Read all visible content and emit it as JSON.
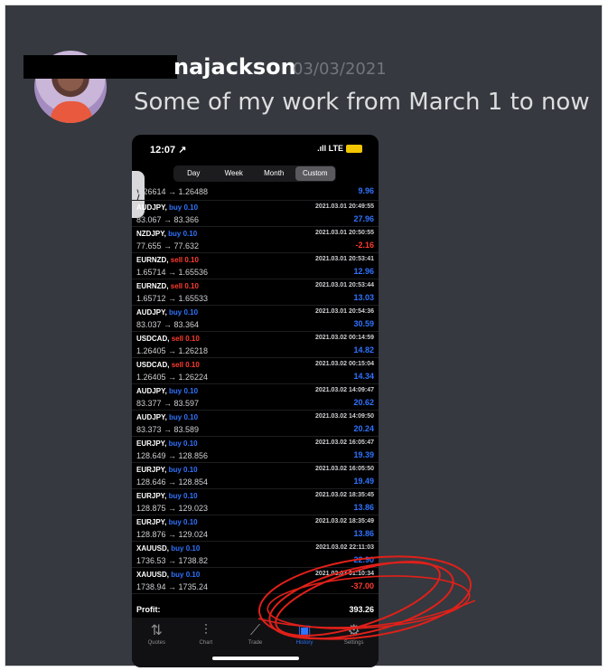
{
  "message": {
    "username": "najackson",
    "timestamp": "03/03/2021",
    "text": "Some of my work from March 1 to now"
  },
  "phone": {
    "clock": "12:07 ↗",
    "network": ".ıll LTE",
    "segments": [
      "Day",
      "Week",
      "Month",
      "Custom"
    ],
    "active_segment": "Custom",
    "side_tab_icon": "chevron-right",
    "trades": [
      {
        "symbol": "",
        "side": "",
        "prices": "1.26614 → 1.26488",
        "time": "",
        "pl": "9.96",
        "partial": true
      },
      {
        "symbol": "AUDJPY,",
        "side": "buy 0.10",
        "prices": "83.067 → 83.366",
        "time": "2021.03.01 20:49:55",
        "pl": "27.96"
      },
      {
        "symbol": "NZDJPY,",
        "side": "buy 0.10",
        "prices": "77.655 → 77.632",
        "time": "2021.03.01 20:50:55",
        "pl": "-2.16"
      },
      {
        "symbol": "EURNZD,",
        "side": "sell 0.10",
        "prices": "1.65714 → 1.65536",
        "time": "2021.03.01 20:53:41",
        "pl": "12.96"
      },
      {
        "symbol": "EURNZD,",
        "side": "sell 0.10",
        "prices": "1.65712 → 1.65533",
        "time": "2021.03.01 20:53:44",
        "pl": "13.03"
      },
      {
        "symbol": "AUDJPY,",
        "side": "buy 0.10",
        "prices": "83.037 → 83.364",
        "time": "2021.03.01 20:54:36",
        "pl": "30.59"
      },
      {
        "symbol": "USDCAD,",
        "side": "sell 0.10",
        "prices": "1.26405 → 1.26218",
        "time": "2021.03.02 00:14:59",
        "pl": "14.82"
      },
      {
        "symbol": "USDCAD,",
        "side": "sell 0.10",
        "prices": "1.26405 → 1.26224",
        "time": "2021.03.02 00:15:04",
        "pl": "14.34"
      },
      {
        "symbol": "AUDJPY,",
        "side": "buy 0.10",
        "prices": "83.377 → 83.597",
        "time": "2021.03.02 14:09:47",
        "pl": "20.62"
      },
      {
        "symbol": "AUDJPY,",
        "side": "buy 0.10",
        "prices": "83.373 → 83.589",
        "time": "2021.03.02 14:09:50",
        "pl": "20.24"
      },
      {
        "symbol": "EURJPY,",
        "side": "buy 0.10",
        "prices": "128.649 → 128.856",
        "time": "2021.03.02 16:05:47",
        "pl": "19.39"
      },
      {
        "symbol": "EURJPY,",
        "side": "buy 0.10",
        "prices": "128.646 → 128.854",
        "time": "2021.03.02 16:05:50",
        "pl": "19.49"
      },
      {
        "symbol": "EURJPY,",
        "side": "buy 0.10",
        "prices": "128.875 → 129.023",
        "time": "2021.03.02 18:35:45",
        "pl": "13.86"
      },
      {
        "symbol": "EURJPY,",
        "side": "buy 0.10",
        "prices": "128.876 → 129.024",
        "time": "2021.03.02 18:35:49",
        "pl": "13.86"
      },
      {
        "symbol": "XAUUSD,",
        "side": "buy 0.10",
        "prices": "1736.53 → 1738.82",
        "time": "2021.03.02 22:11:03",
        "pl": "22.90"
      },
      {
        "symbol": "XAUUSD,",
        "side": "buy 0.10",
        "prices": "1738.94 → 1735.24",
        "time": "2021.03.03 01:10:34",
        "pl": "-37.00"
      }
    ],
    "profit_label": "Profit:",
    "profit_value": "393.26",
    "tabs": [
      {
        "label": "Quotes",
        "icon": "quotes-icon"
      },
      {
        "label": "Chart",
        "icon": "chart-icon"
      },
      {
        "label": "Trade",
        "icon": "trade-icon"
      },
      {
        "label": "History",
        "icon": "history-icon"
      },
      {
        "label": "Settings",
        "icon": "gear-icon"
      }
    ],
    "active_tab": "History"
  },
  "colors": {
    "background": "#36393f",
    "buy": "#2f73ff",
    "sell": "#ff3b30",
    "annotation": "#e0201a"
  }
}
